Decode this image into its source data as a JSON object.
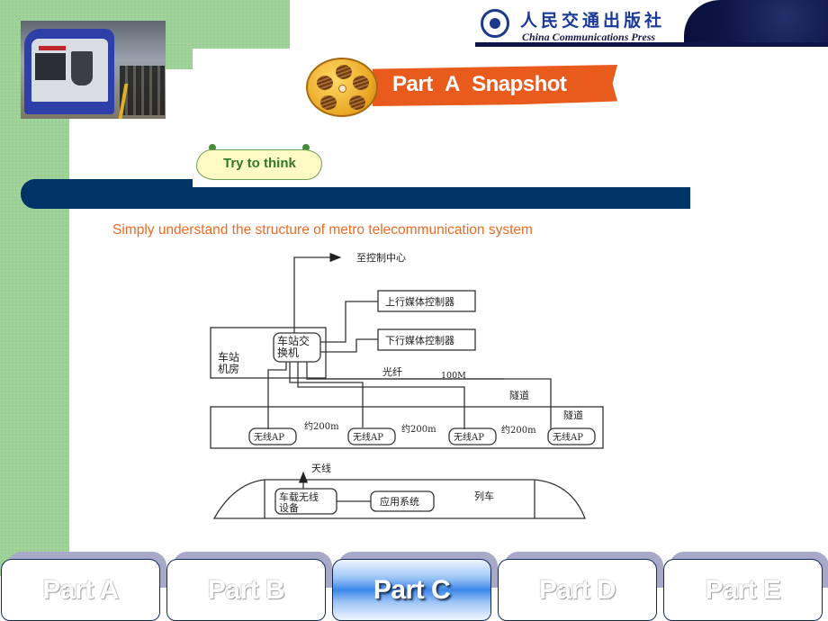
{
  "header": {
    "publisher_cn": "人民交通出版社",
    "publisher_en": "China Communications Press",
    "section_title": "Part A   Snapshot",
    "badge": "Try to think"
  },
  "colors": {
    "accent_orange": "#e95b1c",
    "navy": "#003366",
    "green_bg": "#9fd39a",
    "subtitle": "#ee6a22",
    "active_tab": "#3a86e8"
  },
  "content": {
    "subtitle": "Simply understand the structure of metro telecommunication system"
  },
  "diagram": {
    "to_control_center": "至控制中心",
    "uplink_controller": "上行媒体控制器",
    "downlink_controller": "下行媒体控制器",
    "station_room_line1": "车站",
    "station_room_line2": "机房",
    "switch_line1": "车站交",
    "switch_line2": "换机",
    "fiber": "光纤",
    "bandwidth": "100M",
    "tunnel_upper": "隧道",
    "tunnel_lower": "隧道",
    "access_points": [
      "无线AP",
      "无线AP",
      "无线AP",
      "无线AP"
    ],
    "distances": [
      "约200m",
      "约200m",
      "约200m"
    ],
    "antenna": "天线",
    "onboard_line1": "车载无线",
    "onboard_line2": "设备",
    "app_system": "应用系统",
    "train": "列车"
  },
  "nav": {
    "tabs": [
      {
        "label": "Part A",
        "active": false
      },
      {
        "label": "Part B",
        "active": false
      },
      {
        "label": "Part C",
        "active": true
      },
      {
        "label": "Part D",
        "active": false
      },
      {
        "label": "Part E",
        "active": false
      }
    ]
  }
}
